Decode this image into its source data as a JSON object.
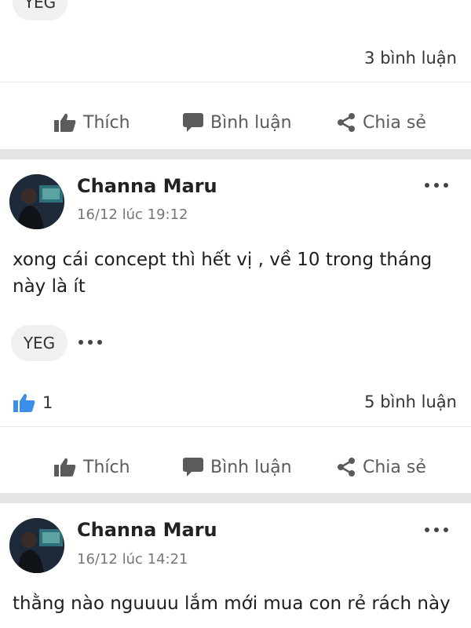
{
  "post0": {
    "tag": "YEG",
    "comments": "3 bình luận"
  },
  "actions": {
    "like": "Thích",
    "comment": "Bình luận",
    "share": "Chia sẻ"
  },
  "post1": {
    "author": "Channa Maru",
    "time": "16/12 lúc 19:12",
    "text": "xong cái concept thì hết vị , về 10 trong tháng này là ít",
    "tag": "YEG",
    "likes": "1",
    "comments": "5 bình luận"
  },
  "post2": {
    "author": "Channa Maru",
    "time": "16/12 lúc 14:21",
    "text": "thằng nào nguuuu lắm mới mua con rẻ rách này"
  },
  "colors": {
    "like_blue": "#3b8eea",
    "divider": "#e4e4e4",
    "muted": "#5b5b5b"
  },
  "icons": [
    "thumbs-up-icon",
    "comment-icon",
    "share-icon",
    "more-icon",
    "like-reaction-icon"
  ]
}
